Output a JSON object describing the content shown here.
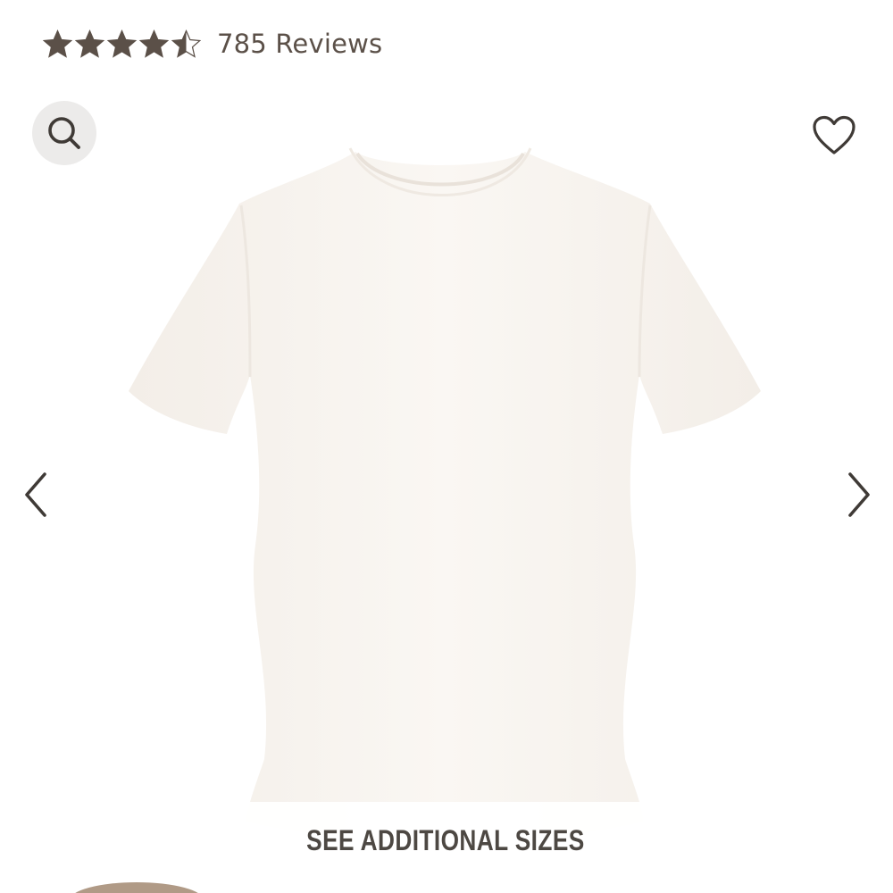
{
  "rating": {
    "value": 4.5,
    "max": 5,
    "reviews_label": "785 Reviews",
    "star_color": "#5b5048"
  },
  "icons": {
    "search": "search-icon",
    "wishlist": "heart-outline-icon",
    "prev": "chevron-left-icon",
    "next": "chevron-right-icon"
  },
  "gallery": {
    "image_alt": "white short sleeve t-shirt",
    "sizes_button_label": "SEE ADDITIONAL SIZES"
  },
  "colors": {
    "text_primary": "#5b5048",
    "garment": "#f7f3ef",
    "search_bg": "#ecebea",
    "swatch": "#b09a86"
  }
}
